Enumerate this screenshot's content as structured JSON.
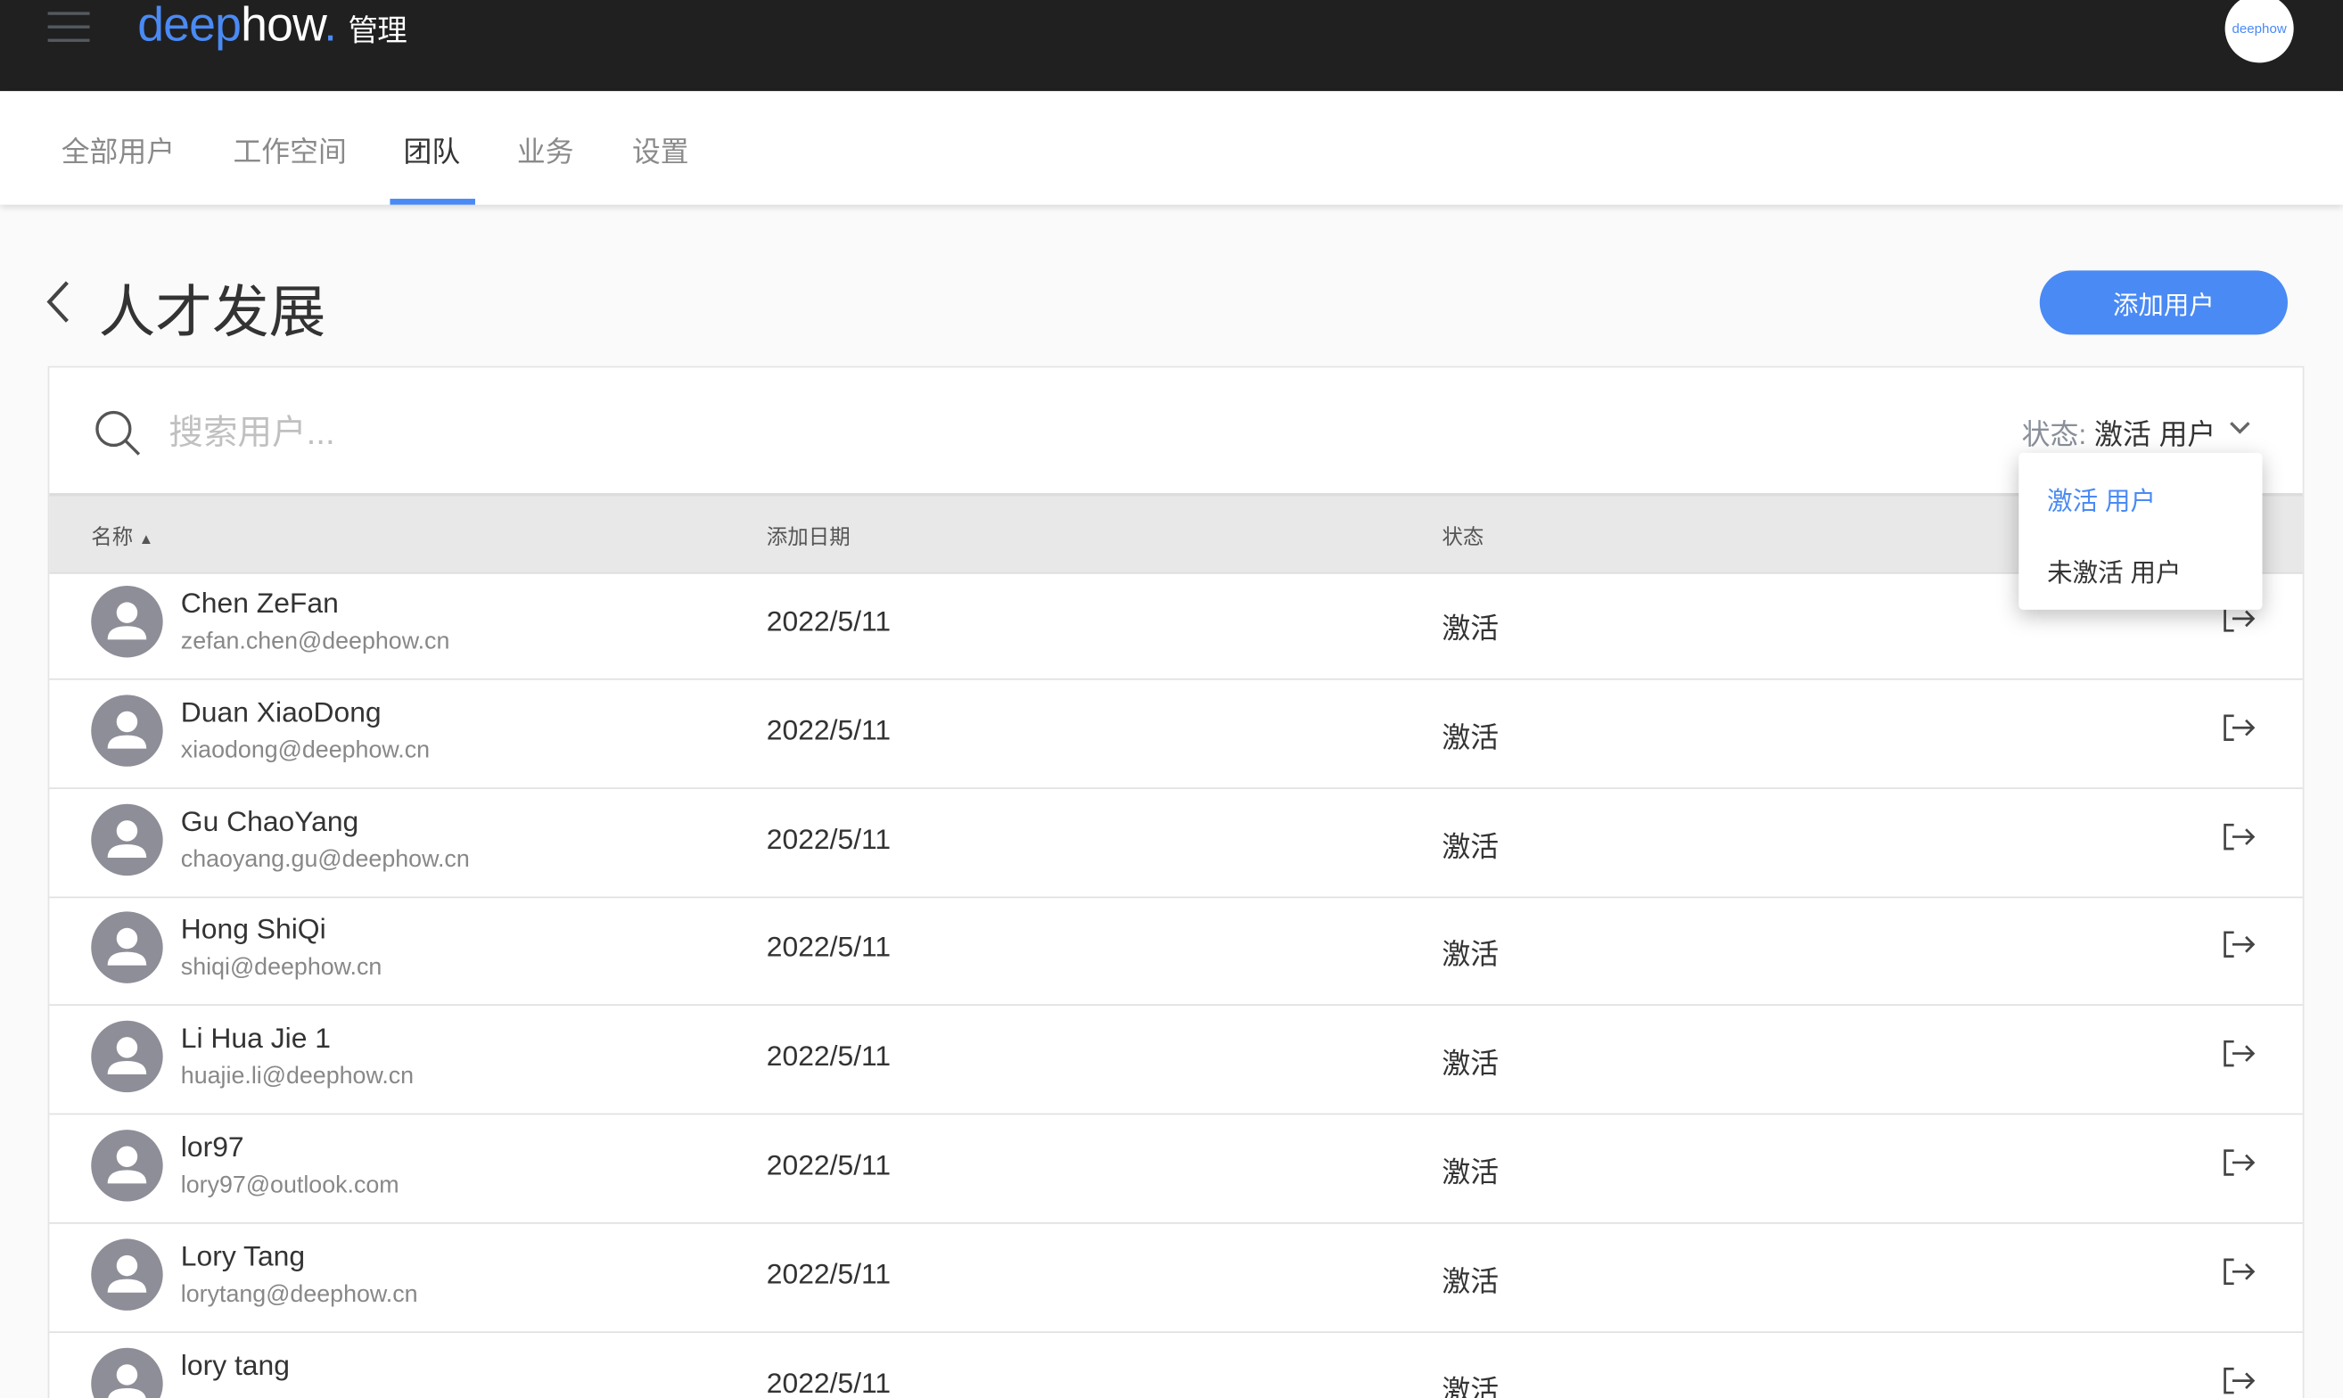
{
  "header": {
    "logo_a": "deep",
    "logo_b": "how",
    "logo_dot": ".",
    "admin": "管理",
    "avatar_text": "deephow"
  },
  "tabs": [
    {
      "label": "全部用户"
    },
    {
      "label": "工作空间"
    },
    {
      "label": "团队",
      "active": true
    },
    {
      "label": "业务"
    },
    {
      "label": "设置"
    }
  ],
  "page": {
    "title": "人才发展",
    "add_button": "添加用户"
  },
  "search": {
    "placeholder": "搜索用户...",
    "value": ""
  },
  "filter": {
    "label": "状态: ",
    "value": "激活 用户",
    "options": [
      "激活 用户",
      "未激活 用户"
    ],
    "selected": "激活 用户"
  },
  "table": {
    "headers": {
      "name": "名称",
      "date": "添加日期",
      "status": "状态"
    },
    "rows": [
      {
        "name": "Chen ZeFan",
        "email": "zefan.chen@deephow.cn",
        "date": "2022/5/11",
        "status": "激活"
      },
      {
        "name": "Duan XiaoDong",
        "email": "xiaodong@deephow.cn",
        "date": "2022/5/11",
        "status": "激活"
      },
      {
        "name": "Gu ChaoYang",
        "email": "chaoyang.gu@deephow.cn",
        "date": "2022/5/11",
        "status": "激活"
      },
      {
        "name": "Hong ShiQi",
        "email": "shiqi@deephow.cn",
        "date": "2022/5/11",
        "status": "激活"
      },
      {
        "name": "Li Hua Jie 1",
        "email": "huajie.li@deephow.cn",
        "date": "2022/5/11",
        "status": "激活"
      },
      {
        "name": "lor97",
        "email": "lory97@outlook.com",
        "date": "2022/5/11",
        "status": "激活"
      },
      {
        "name": "Lory Tang",
        "email": "lorytang@deephow.cn",
        "date": "2022/5/11",
        "status": "激活"
      },
      {
        "name": "lory tang",
        "email": "",
        "date": "2022/5/11",
        "status": "激活"
      }
    ]
  },
  "colors": {
    "accent": "#4a8af4",
    "topbar": "#202020"
  }
}
